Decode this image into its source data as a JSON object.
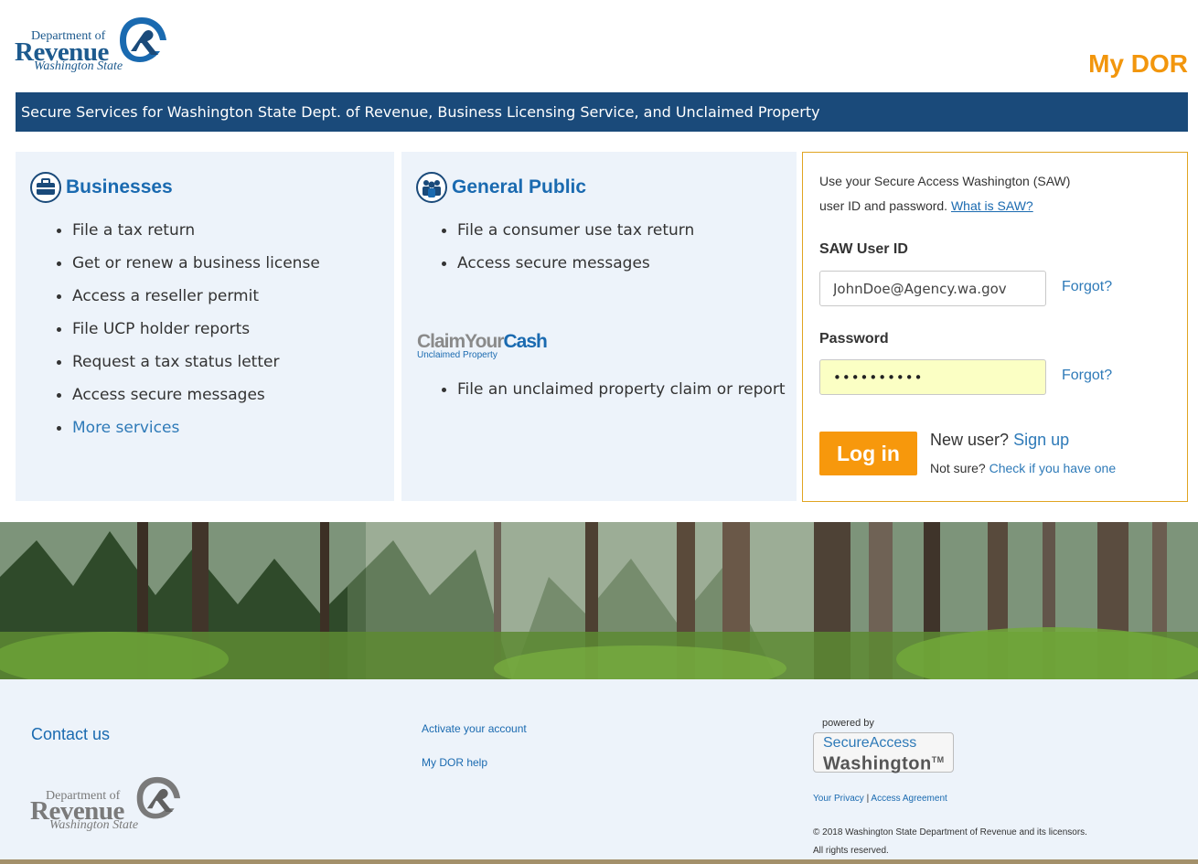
{
  "logo": {
    "dept": "Department of",
    "name": "Revenue",
    "state": "Washington State"
  },
  "app_title": "My DOR",
  "banner": "Secure Services for Washington State Dept. of Revenue, Business Licensing Service, and Unclaimed Property",
  "businesses": {
    "title": "Businesses",
    "items": [
      "File a tax return",
      "Get or renew a business license",
      "Access a reseller permit",
      "File UCP holder reports",
      "Request a tax status letter",
      "Access secure messages"
    ],
    "more_link": "More services"
  },
  "general_public": {
    "title": "General Public",
    "items": [
      "File a consumer use tax return",
      "Access secure messages"
    ],
    "claim_logo": {
      "part1": "ClaimYour",
      "part2": "Cash",
      "sub": "Unclaimed Property"
    },
    "claim_items": [
      "File an unclaimed property claim or report"
    ]
  },
  "login": {
    "intro_line1": "Use your Secure Access Washington (SAW)",
    "intro_line2": "user ID and password.",
    "what_is_saw": "What is SAW?",
    "user_label": "SAW User ID",
    "user_value": "JohnDoe@Agency.wa.gov",
    "forgot_user": "Forgot?",
    "password_label": "Password",
    "password_value": "••••••••••",
    "forgot_password": "Forgot?",
    "login_button": "Log in",
    "new_user_text": "New user?",
    "sign_up": "Sign up",
    "not_sure_text": "Not sure?",
    "check_link": "Check if you have one"
  },
  "footer": {
    "contact": "Contact us",
    "activate": "Activate your account",
    "help": "My DOR help",
    "powered_by": "powered by",
    "saw_line1": "SecureAccess",
    "saw_line2": "Washington",
    "saw_tm": "TM",
    "privacy": "Your Privacy",
    "separator": "|",
    "agreement": "Access Agreement",
    "copyright": "© 2018 Washington State Department of Revenue and its licensors.",
    "rights": "All rights reserved."
  },
  "colors": {
    "brand_blue": "#1a4a7a",
    "link_blue": "#2e7ab8",
    "accent_orange": "#f7980c",
    "panel_bg": "#edf3fa",
    "password_bg": "#fbffc4"
  }
}
